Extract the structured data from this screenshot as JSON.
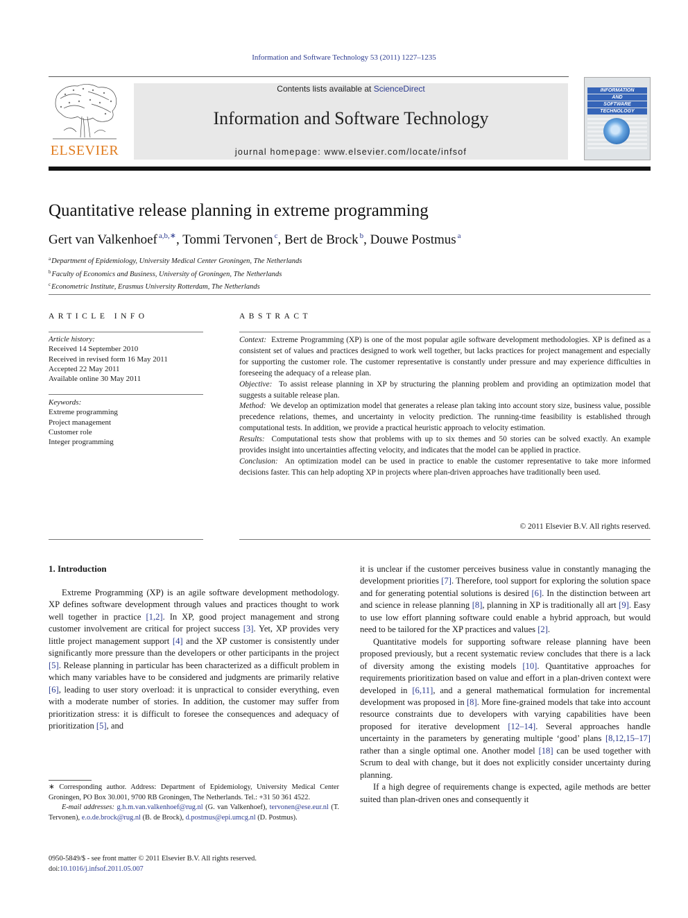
{
  "header": {
    "journal_reference": "Information and Software Technology 53 (2011) 1227–1235",
    "contents_prefix": "Contents lists available at ",
    "contents_link": "ScienceDirect",
    "journal_title": "Information and Software Technology",
    "homepage": "journal homepage: www.elsevier.com/locate/infsof",
    "publisher_logo_text": "ELSEVIER",
    "cover": {
      "bands": [
        "INFORMATION",
        "AND",
        "SOFTWARE",
        "TECHNOLOGY"
      ]
    },
    "colors": {
      "link": "#2b3a8f",
      "publisher_orange": "#e07b1e",
      "cover_blue": "#3564b8"
    }
  },
  "article": {
    "title": "Quantitative release planning in extreme programming",
    "authors": [
      {
        "name": "Gert van Valkenhoef",
        "sup": "a,b,∗",
        "sep": ", "
      },
      {
        "name": "Tommi Tervonen",
        "sup": "c",
        "sep": ", "
      },
      {
        "name": "Bert de Brock",
        "sup": "b",
        "sep": ", "
      },
      {
        "name": "Douwe Postmus",
        "sup": "a",
        "sep": ""
      }
    ],
    "affiliations": [
      {
        "key": "a",
        "text": "Department of Epidemiology, University Medical Center Groningen, The Netherlands"
      },
      {
        "key": "b",
        "text": "Faculty of Economics and Business, University of Groningen, The Netherlands"
      },
      {
        "key": "c",
        "text": "Econometric Institute, Erasmus University Rotterdam, The Netherlands"
      }
    ]
  },
  "article_info": {
    "heading": "ARTICLE INFO",
    "history_label": "Article history:",
    "history": [
      "Received 14 September 2010",
      "Received in revised form 16 May 2011",
      "Accepted 22 May 2011",
      "Available online 30 May 2011"
    ],
    "keywords_label": "Keywords:",
    "keywords": [
      "Extreme programming",
      "Project management",
      "Customer role",
      "Integer programming"
    ]
  },
  "abstract": {
    "heading": "ABSTRACT",
    "sections": [
      {
        "label": "Context:",
        "text": "Extreme Programming (XP) is one of the most popular agile software development methodologies. XP is defined as a consistent set of values and practices designed to work well together, but lacks practices for project management and especially for supporting the customer role. The customer representative is constantly under pressure and may experience difficulties in foreseeing the adequacy of a release plan."
      },
      {
        "label": "Objective:",
        "text": "To assist release planning in XP by structuring the planning problem and providing an optimization model that suggests a suitable release plan."
      },
      {
        "label": "Method:",
        "text": "We develop an optimization model that generates a release plan taking into account story size, business value, possible precedence relations, themes, and uncertainty in velocity prediction. The running-time feasibility is established through computational tests. In addition, we provide a practical heuristic approach to velocity estimation."
      },
      {
        "label": "Results:",
        "text": "Computational tests show that problems with up to six themes and 50 stories can be solved exactly. An example provides insight into uncertainties affecting velocity, and indicates that the model can be applied in practice."
      },
      {
        "label": "Conclusion:",
        "text": "An optimization model can be used in practice to enable the customer representative to take more informed decisions faster. This can help adopting XP in projects where plan-driven approaches have traditionally been used."
      }
    ],
    "copyright": "© 2011 Elsevier B.V. All rights reserved."
  },
  "body": {
    "section_heading": "1. Introduction",
    "left_paragraphs": [
      [
        {
          "t": "Extreme Programming (XP) is an agile software development methodology. XP defines software development through values and practices thought to work well together in practice "
        },
        {
          "ref": "[1,2]"
        },
        {
          "t": ". In XP, good project management and strong customer involvement are critical for project success "
        },
        {
          "ref": "[3]"
        },
        {
          "t": ". Yet, XP provides very little project management support "
        },
        {
          "ref": "[4]"
        },
        {
          "t": " and the XP customer is consistently under significantly more pressure than the developers or other participants in the project "
        },
        {
          "ref": "[5]"
        },
        {
          "t": ". Release planning in particular has been characterized as a difficult problem in which many variables have to be considered and judgments are primarily relative "
        },
        {
          "ref": "[6]"
        },
        {
          "t": ", leading to user story overload: it is unpractical to consider everything, even with a moderate number of stories. In addition, the customer may suffer from prioritization stress: it is difficult to foresee the consequences and adequacy of prioritization "
        },
        {
          "ref": "[5]"
        },
        {
          "t": ", and"
        }
      ]
    ],
    "right_paragraphs": [
      [
        {
          "t": "it is unclear if the customer perceives business value in constantly managing the development priorities "
        },
        {
          "ref": "[7]"
        },
        {
          "t": ". Therefore, tool support for exploring the solution space and for generating potential solutions is desired "
        },
        {
          "ref": "[6]"
        },
        {
          "t": ". In the distinction between art and science in release planning "
        },
        {
          "ref": "[8]"
        },
        {
          "t": ", planning in XP is traditionally all art "
        },
        {
          "ref": "[9]"
        },
        {
          "t": ". Easy to use low effort planning software could enable a hybrid approach, but would need to be tailored for the XP practices and values "
        },
        {
          "ref": "[2]"
        },
        {
          "t": "."
        }
      ],
      [
        {
          "t": "Quantitative models for supporting software release planning have been proposed previously, but a recent systematic review concludes that there is a lack of diversity among the existing models "
        },
        {
          "ref": "[10]"
        },
        {
          "t": ". Quantitative approaches for requirements prioritization based on value and effort in a plan-driven context were developed in "
        },
        {
          "ref": "[6,11]"
        },
        {
          "t": ", and a general mathematical formulation for incremental development was proposed in "
        },
        {
          "ref": "[8]"
        },
        {
          "t": ". More fine-grained models that take into account resource constraints due to developers with varying capabilities have been proposed for iterative development "
        },
        {
          "ref": "[12–14]"
        },
        {
          "t": ". Several approaches handle uncertainty in the parameters by generating multiple ‘good’ plans "
        },
        {
          "ref": "[8,12,15–17]"
        },
        {
          "t": " rather than a single optimal one. Another model "
        },
        {
          "ref": "[18]"
        },
        {
          "t": " can be used together with Scrum to deal with change, but it does not explicitly consider uncertainty during planning."
        }
      ],
      [
        {
          "t": "If a high degree of requirements change is expected, agile methods are better suited than plan-driven ones and consequently it"
        }
      ]
    ]
  },
  "footnotes": {
    "corresponding": "∗ Corresponding author. Address: Department of Epidemiology, University Medical Center Groningen, PO Box 30.001, 9700 RB Groningen, The Netherlands. Tel.: +31 50 361 4522.",
    "email_label": "E-mail addresses:",
    "emails": [
      {
        "address": "g.h.m.van.valkenhoef@rug.nl",
        "who": " (G. van Valkenhoef), "
      },
      {
        "address": "tervonen@ese.eur.nl",
        "who": " (T. Tervonen), "
      },
      {
        "address": "e.o.de.brock@rug.nl",
        "who": " (B. de Brock), "
      },
      {
        "address": "d.postmus@epi.umcg.nl",
        "who": " (D. Postmus)."
      }
    ],
    "front_matter": "0950-5849/$ - see front matter © 2011 Elsevier B.V. All rights reserved.",
    "doi_prefix": "doi:",
    "doi": "10.1016/j.infsof.2011.05.007"
  }
}
